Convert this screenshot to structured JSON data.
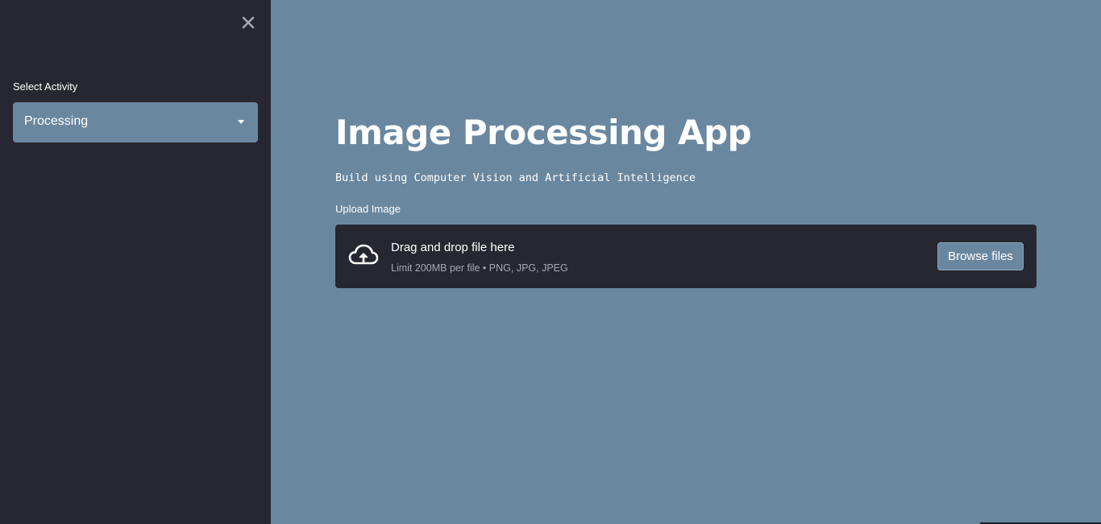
{
  "sidebar": {
    "close_icon": "close-icon",
    "select_label": "Select Activity",
    "select_value": "Processing"
  },
  "main": {
    "title": "Image Processing App",
    "subtitle": "Build using Computer Vision and Artificial Intelligence",
    "uploader": {
      "label": "Upload Image",
      "drop_title": "Drag and drop file here",
      "drop_hint": "Limit 200MB per file • PNG, JPG, JPEG",
      "browse_label": "Browse files",
      "icon": "cloud-upload-icon"
    }
  },
  "colors": {
    "sidebar_bg": "#262730",
    "main_bg": "#6a87a0",
    "text": "#ffffff"
  }
}
